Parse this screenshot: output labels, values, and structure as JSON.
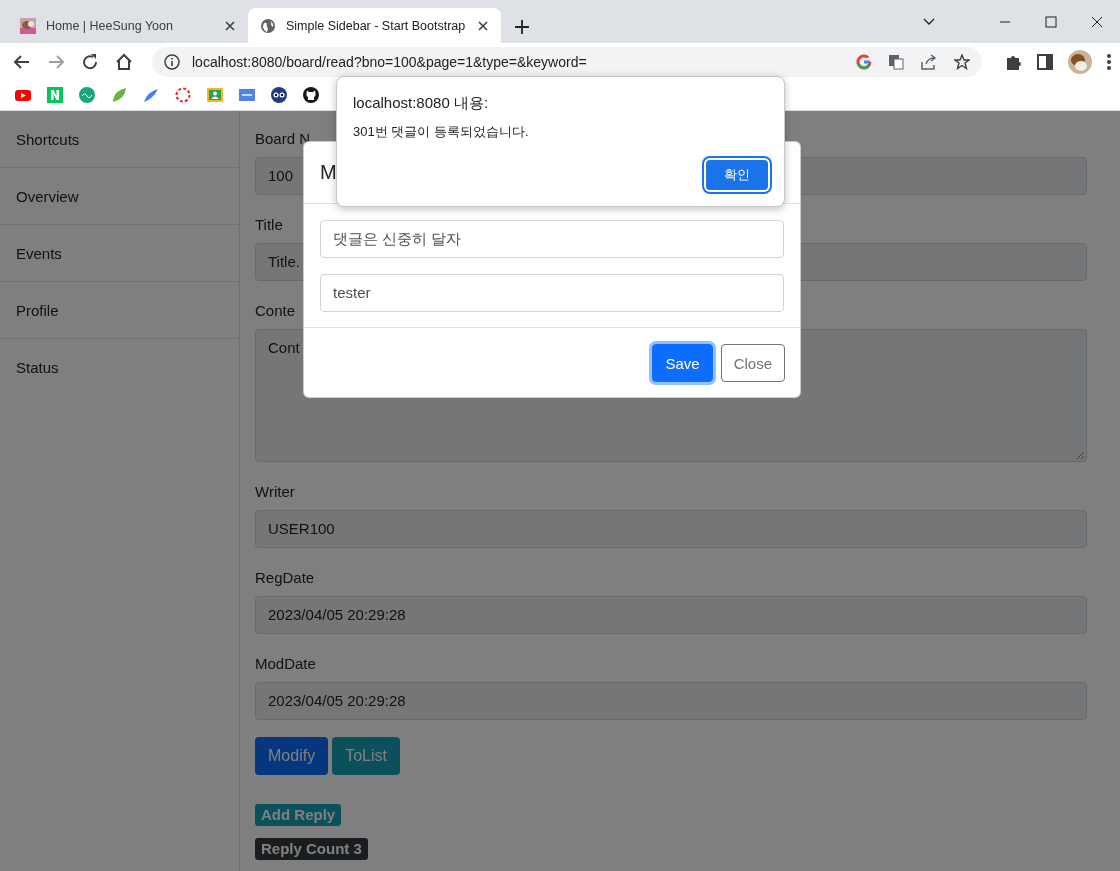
{
  "browser": {
    "tabs": [
      {
        "title": "Home | HeeSung Yoon",
        "selected": false
      },
      {
        "title": "Simple Sidebar - Start Bootstrap",
        "selected": true
      }
    ],
    "url": "localhost:8080/board/read?bno=100&page=1&type=&keyword="
  },
  "sidebar": {
    "items": [
      "Shortcuts",
      "Overview",
      "Events",
      "Profile",
      "Status"
    ]
  },
  "form": {
    "fields": [
      {
        "label": "Board N",
        "value": "100",
        "kind": "input"
      },
      {
        "label": "Title",
        "value": "Title.",
        "kind": "input"
      },
      {
        "label": "Conte",
        "value": "Cont",
        "kind": "textarea"
      },
      {
        "label": "Writer",
        "value": "USER100",
        "kind": "input"
      },
      {
        "label": "RegDate",
        "value": "2023/04/05 20:29:28",
        "kind": "input"
      },
      {
        "label": "ModDate",
        "value": "2023/04/05 20:29:28",
        "kind": "input"
      }
    ],
    "buttons": [
      {
        "label": "Modify"
      },
      {
        "label": "ToList"
      }
    ],
    "badges": [
      {
        "label": "Add Reply"
      },
      {
        "label": "Reply Count 3"
      }
    ]
  },
  "modal": {
    "title": "M",
    "fields": [
      {
        "value": "댓글은 신중히 달자"
      },
      {
        "value": "tester"
      }
    ],
    "buttons": [
      {
        "label": "Save",
        "focused": true
      },
      {
        "label": "Close",
        "focused": false
      }
    ]
  },
  "alert": {
    "title": "localhost:8080 내용:",
    "message": "301번 댓글이 등록되었습니다.",
    "button": {
      "label": "확인",
      "focused": true
    }
  }
}
